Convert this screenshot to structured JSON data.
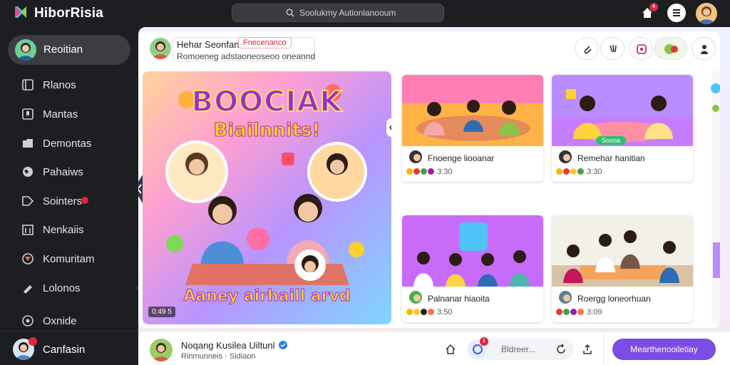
{
  "app": {
    "name": "HiborRisia",
    "accent": "#7c4ce3"
  },
  "search": {
    "placeholder": "Soolukmy Autionlanooum"
  },
  "topbar": {
    "notifications_badge": "4"
  },
  "sidebar": {
    "active_item": "Reoitian",
    "items": [
      {
        "label": "Rlanos",
        "icon": "book-icon"
      },
      {
        "label": "Mantas",
        "icon": "bookmark-icon"
      },
      {
        "label": "Demontas",
        "icon": "folder-icon"
      },
      {
        "label": "Pahaiws",
        "icon": "globe-icon"
      },
      {
        "label": "Sointers",
        "icon": "tag-icon",
        "badge": true
      },
      {
        "label": "Nenkaiis",
        "icon": "calendar-icon"
      },
      {
        "label": "Komuritam",
        "icon": "community-icon"
      },
      {
        "label": "Lolonos",
        "icon": "megaphone-icon",
        "expandable": true
      },
      {
        "label": "Oxnide",
        "icon": "settings-icon"
      }
    ],
    "bottom_user": {
      "label": "Canfasin"
    }
  },
  "header": {
    "name": "Hehar Seonfan",
    "tag": "Fnecenanco",
    "subtitle": "Romoeneg adstaoneoseoo oneannd"
  },
  "hero": {
    "title": "BOOCIAK",
    "subtitle": "Biailnnits!",
    "caption": "Aaney airhaill arvd",
    "duration": "0:49 5"
  },
  "cards": [
    {
      "title": "Fnoenge liooanar",
      "meta": "3:30",
      "chip": ""
    },
    {
      "title": "Remehar hanitian",
      "meta": "3:30",
      "chip": "Soooa"
    },
    {
      "title": "Palnanar hiaoita",
      "meta": "3:50",
      "chip": ""
    },
    {
      "title": "Roergg loneorhuan",
      "meta": "3:09",
      "chip": ""
    }
  ],
  "bottombar": {
    "name": "Noqang Kusilea Uiltunl",
    "subtitle": "Rinmunneis · Sidiaon",
    "comment_placeholder": "Bldreer...",
    "comment_badge": "1",
    "cta": "Mearthenooiletiay"
  }
}
